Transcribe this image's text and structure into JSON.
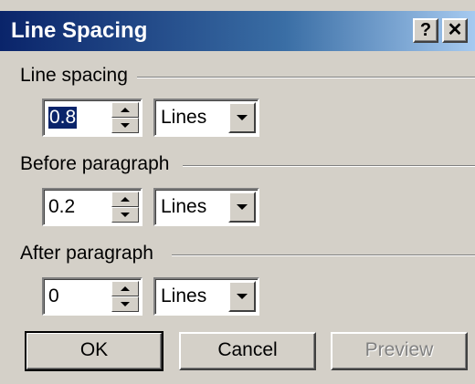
{
  "window": {
    "title": "Line Spacing",
    "help_label": "?",
    "close_label": "✕"
  },
  "line_spacing": {
    "label": "Line spacing",
    "value": "0.8",
    "unit": "Lines"
  },
  "before_paragraph": {
    "label": "Before paragraph",
    "value": "0.2",
    "unit": "Lines"
  },
  "after_paragraph": {
    "label": "After paragraph",
    "value": "0",
    "unit": "Lines"
  },
  "buttons": {
    "ok": "OK",
    "cancel": "Cancel",
    "preview": "Preview",
    "preview_enabled": false
  }
}
